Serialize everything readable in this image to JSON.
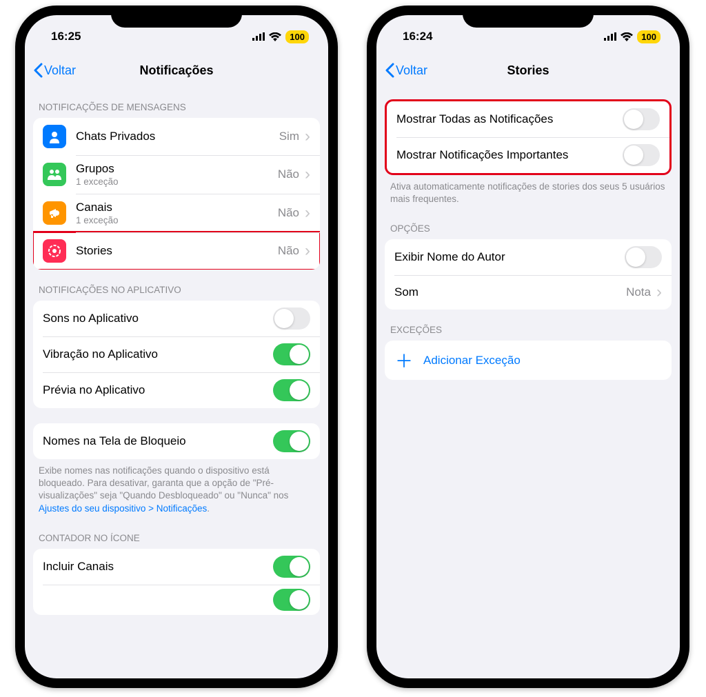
{
  "left": {
    "status": {
      "time": "16:25",
      "battery": "100"
    },
    "nav": {
      "back": "Voltar",
      "title": "Notificações"
    },
    "sections": {
      "msg_header": "NOTIFICAÇÕES DE MENSAGENS",
      "chats": {
        "label": "Chats Privados",
        "value": "Sim"
      },
      "groups": {
        "label": "Grupos",
        "sub": "1 exceção",
        "value": "Não"
      },
      "channels": {
        "label": "Canais",
        "sub": "1 exceção",
        "value": "Não"
      },
      "stories": {
        "label": "Stories",
        "value": "Não"
      },
      "app_header": "NOTIFICAÇÕES NO APLICATIVO",
      "app_sounds": "Sons no Aplicativo",
      "app_vibrate": "Vibração no Aplicativo",
      "app_preview": "Prévia no Aplicativo",
      "lockscreen": "Nomes na Tela de Bloqueio",
      "lockscreen_footer_1": "Exibe nomes nas notificações quando o dispositivo está bloqueado. Para desativar, garanta que a opção de \"Pré-visualizações\" seja \"Quando Desbloqueado\" ou \"Nunca\" nos ",
      "lockscreen_footer_link": "Ajustes do seu dispositivo > Notificações",
      "lockscreen_footer_2": ".",
      "badge_header": "CONTADOR NO ÍCONE",
      "include_channels": "Incluir Canais"
    }
  },
  "right": {
    "status": {
      "time": "16:24",
      "battery": "100"
    },
    "nav": {
      "back": "Voltar",
      "title": "Stories"
    },
    "rows": {
      "show_all": "Mostrar Todas as Notificações",
      "show_important": "Mostrar Notificações Importantes",
      "footer_stories": "Ativa automaticamente notificações de stories dos seus 5 usuários mais frequentes.",
      "options_header": "OPÇÕES",
      "show_author": "Exibir Nome do Autor",
      "sound_label": "Som",
      "sound_value": "Nota",
      "exceptions_header": "EXCEÇÕES",
      "add_exception": "Adicionar Exceção"
    }
  },
  "colors": {
    "blue_icon": "#007aff",
    "green_icon": "#34c759",
    "orange_icon": "#ff9500",
    "pink_icon": "#ff2d55"
  }
}
